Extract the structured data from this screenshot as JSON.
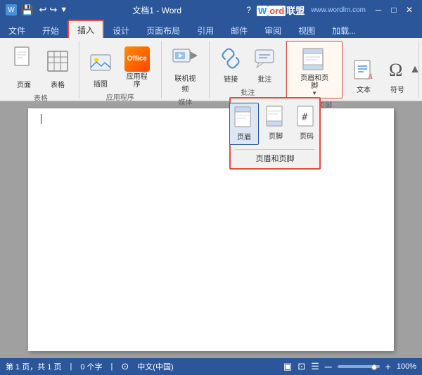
{
  "titlebar": {
    "title": "文档1 - Word",
    "question_mark": "?",
    "save_icon": "💾",
    "undo_icon": "↩",
    "redo_icon": "↪",
    "min_btn": "─",
    "max_btn": "□",
    "close_btn": "✕",
    "wordlm_text": "Word联盟",
    "wordlm_url": "www.wordlm.com"
  },
  "tabs": [
    {
      "label": "文件",
      "active": false,
      "highlighted": false
    },
    {
      "label": "开始",
      "active": false,
      "highlighted": false
    },
    {
      "label": "插入",
      "active": false,
      "highlighted": true
    },
    {
      "label": "设计",
      "active": false,
      "highlighted": false
    },
    {
      "label": "页面布局",
      "active": false,
      "highlighted": false
    },
    {
      "label": "引用",
      "active": false,
      "highlighted": false
    },
    {
      "label": "邮件",
      "active": false,
      "highlighted": false
    },
    {
      "label": "审阅",
      "active": false,
      "highlighted": false
    },
    {
      "label": "视图",
      "active": false,
      "highlighted": false
    },
    {
      "label": "加载...",
      "active": false,
      "highlighted": false
    }
  ],
  "ribbon": {
    "groups": [
      {
        "label": "表格",
        "items": [
          {
            "icon": "page",
            "label": "页面",
            "type": "big"
          },
          {
            "icon": "table",
            "label": "表格",
            "type": "big"
          }
        ]
      },
      {
        "label": "应用程序",
        "items": [
          {
            "icon": "picture",
            "label": "插图",
            "type": "big"
          },
          {
            "icon": "office",
            "label": "Office\n应用程序",
            "type": "big"
          }
        ]
      },
      {
        "label": "媒体",
        "items": [
          {
            "icon": "video",
            "label": "联机视频",
            "type": "big"
          }
        ]
      },
      {
        "label": "批注",
        "items": [
          {
            "icon": "link",
            "label": "链接",
            "type": "big"
          },
          {
            "icon": "comment",
            "label": "批注",
            "type": "big"
          }
        ]
      },
      {
        "label": "页眉和页脚",
        "active": true,
        "items": [
          {
            "icon": "header",
            "label": "页眉和页脚",
            "type": "big",
            "has_arrow": true
          }
        ]
      },
      {
        "label": "",
        "items": [
          {
            "icon": "textbox",
            "label": "文本",
            "type": "big"
          },
          {
            "icon": "omega",
            "label": "符号",
            "type": "big"
          }
        ]
      }
    ],
    "scroll_icon": "▲"
  },
  "dropdown": {
    "visible": true,
    "label": "页眉和页脚",
    "items": [
      {
        "icon": "header_icon",
        "label": "页眉",
        "selected": true
      },
      {
        "icon": "footer_icon",
        "label": "页脚"
      },
      {
        "icon": "pagenum_icon",
        "label": "页码"
      }
    ]
  },
  "document": {
    "content": ""
  },
  "statusbar": {
    "page_info": "第 1 页，共 1 页",
    "char_count": "0 个字",
    "language": "中文(中国)",
    "zoom": "100%",
    "zoom_minus": "─",
    "zoom_plus": "+"
  }
}
